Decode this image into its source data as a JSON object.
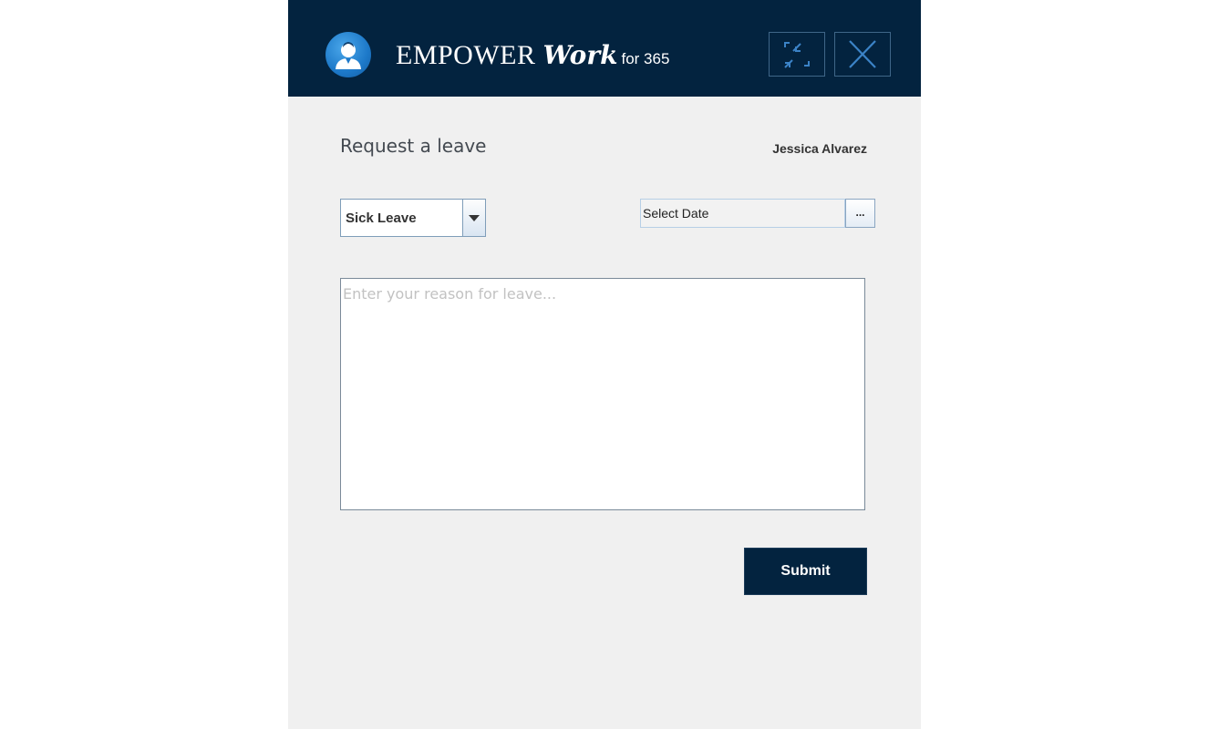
{
  "header": {
    "brand_main": "EMPOWER",
    "brand_work": "Work",
    "brand_sub": "for 365",
    "restore_icon": "restore-collapse-icon",
    "close_icon": "close-icon",
    "background_color": "#03233f"
  },
  "form": {
    "title": "Request a leave",
    "user_name": "Jessica Alvarez",
    "leave_type": {
      "selected": "Sick Leave"
    },
    "date": {
      "value": "Select Date",
      "picker_label": "..."
    },
    "reason": {
      "placeholder": "Enter your reason for leave..."
    },
    "submit_label": "Submit"
  }
}
